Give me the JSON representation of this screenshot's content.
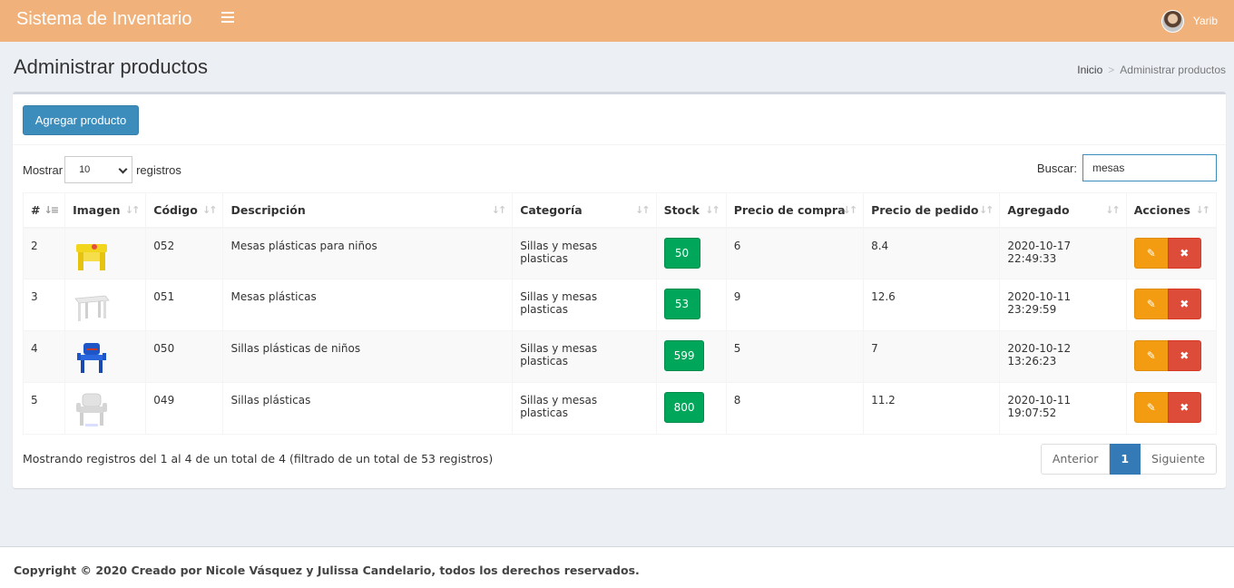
{
  "app": {
    "title": "Sistema de Inventario",
    "user_name": "Yarib"
  },
  "page": {
    "title": "Administrar productos"
  },
  "breadcrumb": {
    "home": "Inicio",
    "current": "Administrar productos"
  },
  "actions": {
    "add_label": "Agregar producto"
  },
  "table_controls": {
    "show_label": "Mostrar",
    "show_value": "10",
    "records_label": "registros",
    "search_label": "Buscar:",
    "search_value": "mesas"
  },
  "columns": [
    "#",
    "Imagen",
    "Código",
    "Descripción",
    "Categoría",
    "Stock",
    "Precio de compra",
    "Precio de pedido",
    "Agregado",
    "Acciones"
  ],
  "rows": [
    {
      "num": "2",
      "code": "052",
      "desc": "Mesas plásticas para niños",
      "cat": "Sillas y mesas plasticas",
      "stock": "50",
      "buy": "6",
      "sell": "8.4",
      "added": "2020-10-17 22:49:33",
      "image": "yellow-kids-table"
    },
    {
      "num": "3",
      "code": "051",
      "desc": "Mesas plásticas",
      "cat": "Sillas y mesas plasticas",
      "stock": "53",
      "buy": "9",
      "sell": "12.6",
      "added": "2020-10-11 23:29:59",
      "image": "white-table"
    },
    {
      "num": "4",
      "code": "050",
      "desc": "Sillas plásticas de niños",
      "cat": "Sillas y mesas plasticas",
      "stock": "599",
      "buy": "5",
      "sell": "7",
      "added": "2020-10-12 13:26:23",
      "image": "blue-kids-chair"
    },
    {
      "num": "5",
      "code": "049",
      "desc": "Sillas plásticas",
      "cat": "Sillas y mesas plasticas",
      "stock": "800",
      "buy": "8",
      "sell": "11.2",
      "added": "2020-10-11 19:07:52",
      "image": "white-chair"
    }
  ],
  "footer_info": {
    "summary": "Mostrando registros del 1 al 4 de un total de 4 (filtrado de un total de 53 registros)",
    "prev": "Anterior",
    "page": "1",
    "next": "Siguiente"
  },
  "footer": {
    "copyright": "Copyright © 2020 Creado por Nicole Vásquez y Julissa Candelario, todos los derechos reservados."
  },
  "colors": {
    "topbar": "#f0b27a",
    "primary": "#3c8dbc",
    "stock": "#00a65a",
    "edit": "#f39c12",
    "delete": "#dd4b39"
  }
}
